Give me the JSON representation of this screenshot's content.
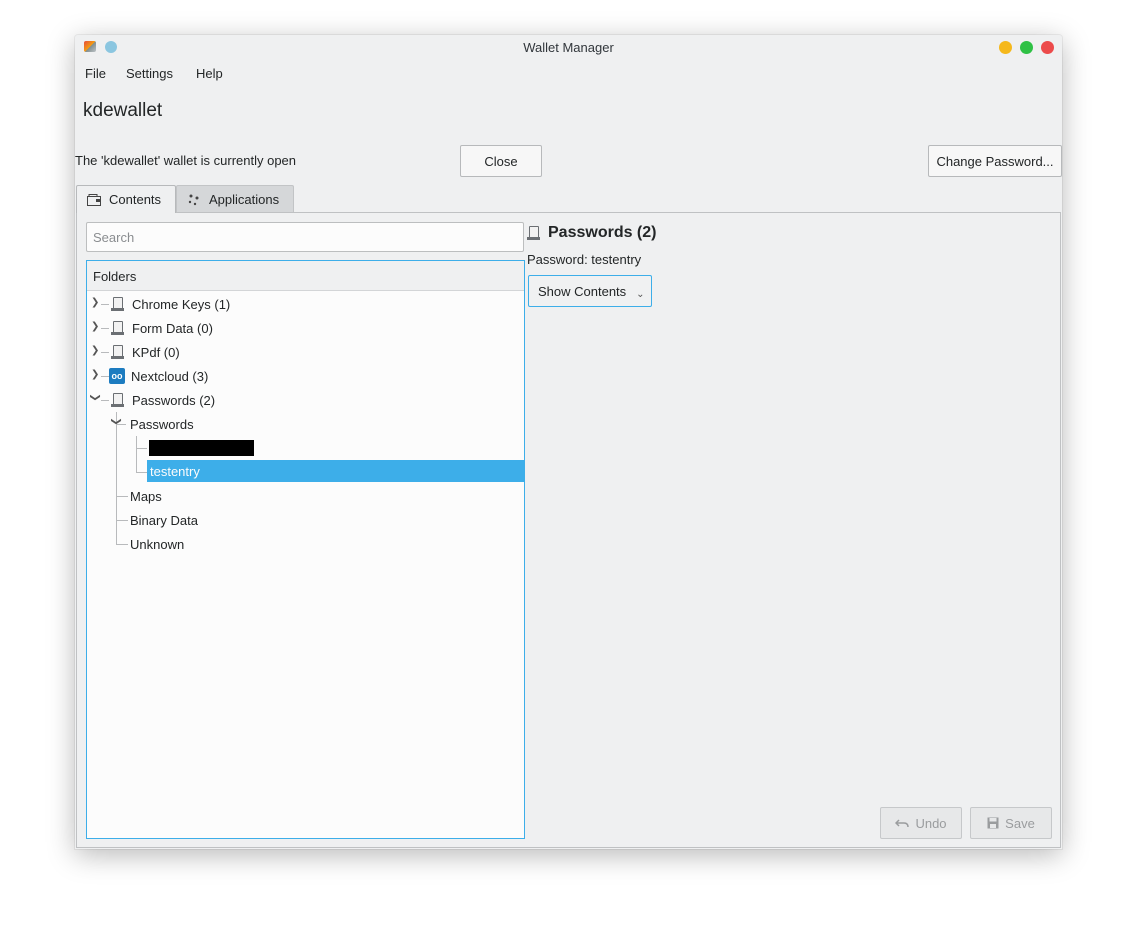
{
  "window": {
    "title": "Wallet Manager"
  },
  "menu": {
    "file": "File",
    "settings": "Settings",
    "help": "Help"
  },
  "wallet": {
    "name": "kdewallet",
    "status": "The 'kdewallet' wallet is currently open",
    "close_label": "Close",
    "change_password_label": "Change Password..."
  },
  "tabs": [
    {
      "label": "Contents",
      "icon": "wallet-icon",
      "active": true
    },
    {
      "label": "Applications",
      "icon": "applications-icon",
      "active": false
    }
  ],
  "search": {
    "placeholder": "Search",
    "value": ""
  },
  "tree": {
    "header": "Folders",
    "folders": [
      {
        "label": "Chrome Keys (1)",
        "expanded": false,
        "icon": "folder-icon"
      },
      {
        "label": "Form Data (0)",
        "expanded": false,
        "icon": "folder-icon"
      },
      {
        "label": "KPdf (0)",
        "expanded": false,
        "icon": "folder-icon"
      },
      {
        "label": "Nextcloud (3)",
        "expanded": false,
        "icon": "nextcloud-icon"
      },
      {
        "label": "Passwords (2)",
        "expanded": true,
        "icon": "folder-icon"
      }
    ],
    "subfolders": [
      {
        "label": "Passwords",
        "expanded": true
      },
      {
        "label": "Maps"
      },
      {
        "label": "Binary Data"
      },
      {
        "label": "Unknown"
      }
    ],
    "entries": [
      {
        "label": "",
        "redacted": true
      },
      {
        "label": "testentry",
        "selected": true
      }
    ]
  },
  "detail": {
    "title": "Passwords (2)",
    "subtitle": "Password: testentry",
    "show_contents_label": "Show Contents"
  },
  "footer": {
    "undo_label": "Undo",
    "save_label": "Save"
  },
  "colors": {
    "accent": "#3daee9",
    "selection": "#3daee9",
    "window_bg": "#eff0f1"
  }
}
